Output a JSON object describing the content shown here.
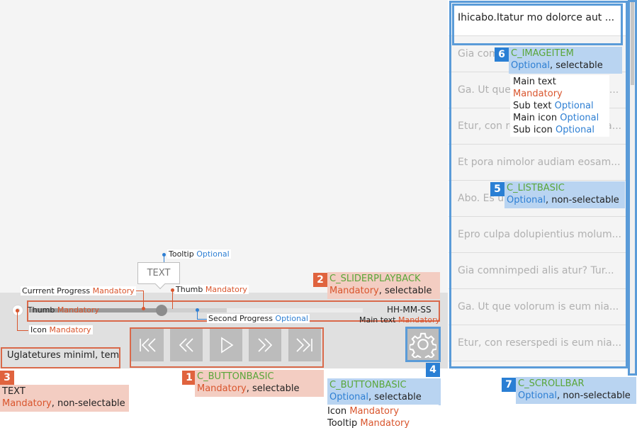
{
  "slider": {
    "tooltip_text": "TEXT",
    "time_text": "HH-MM-SS",
    "current_progress": 0.39,
    "second_progress": 0.59
  },
  "text_field": {
    "value": "Uglatetures miniml, tem.."
  },
  "list": {
    "items": [
      "Ihicabo.Itatur mo dolorce aut ...",
      "Gia comnimpedi alis atur? Tur...",
      "Ga. Ut que volorum is eum nia...",
      "Etur, con reserspedi is eum nia...",
      "Et pora nimolor audiam eosam...",
      "Abo. Es ut volorum is eum nia...",
      "Epro culpa dolupientius molum...",
      "Gia comnimpedi alis atur? Tur...",
      "Ga. Ut que volorum is eum nia...",
      "Etur, con reserspedi is eum nia..."
    ]
  },
  "annotations": {
    "a1": {
      "num": "1",
      "name": "C_BUTTONBASIC",
      "req": "Mandatory",
      "sel": ", selectable"
    },
    "a2": {
      "num": "2",
      "name": "C_SLIDERPLAYBACK",
      "req": "Mandatory",
      "sel": ", selectable"
    },
    "a3": {
      "num": "3",
      "name": "TEXT",
      "req": "Mandatory",
      "sel": ", non-selectable"
    },
    "a4": {
      "num": "4",
      "name": "C_BUTTONBASIC",
      "req": "Optional",
      "sel": ", selectable",
      "sub": [
        {
          "k": "Icon ",
          "v": "Mandatory"
        },
        {
          "k": "Tooltip ",
          "v": "Mandatory"
        }
      ]
    },
    "a5": {
      "num": "5",
      "name": "C_LISTBASIC",
      "req": "Optional",
      "sel": ", non-selectable"
    },
    "a6": {
      "num": "6",
      "name": "C_IMAGEITEM",
      "req": "Optional",
      "sel": ", selectable",
      "sub": [
        {
          "k": "Main text ",
          "v": "Mandatory"
        },
        {
          "k": "Sub text ",
          "v": "Optional"
        },
        {
          "k": "Main icon ",
          "v": "Optional"
        },
        {
          "k": "Sub icon ",
          "v": "Optional"
        }
      ]
    },
    "a7": {
      "num": "7",
      "name": "C_SCROLLBAR",
      "req": "Optional",
      "sel": ", non-selectable"
    }
  },
  "notes": {
    "tooltip": {
      "k": "Tooltip ",
      "v": "Optional"
    },
    "current": {
      "k": "Currrent Progress ",
      "v": "Mandatory"
    },
    "thumb": {
      "k": "Thumb ",
      "v": "Mandatory"
    },
    "thumb2": {
      "k": "Thumb ",
      "v": "Mandatory"
    },
    "icon": {
      "k": "Icon ",
      "v": "Mandatory"
    },
    "second": {
      "k": "Second Progress ",
      "v": "Optional"
    },
    "maintext": {
      "k": "Main text ",
      "v": "Mandatory"
    }
  },
  "colors": {
    "mandatory": "#d9552d",
    "optional": "#2e7fd3",
    "component": "#5aa63a",
    "outline_red": "#d9694a",
    "outline_blue": "#5a9bd8"
  },
  "icons": [
    "skip-back-icon",
    "rewind-icon",
    "play-icon",
    "fast-forward-icon",
    "skip-forward-icon",
    "gear-icon"
  ]
}
